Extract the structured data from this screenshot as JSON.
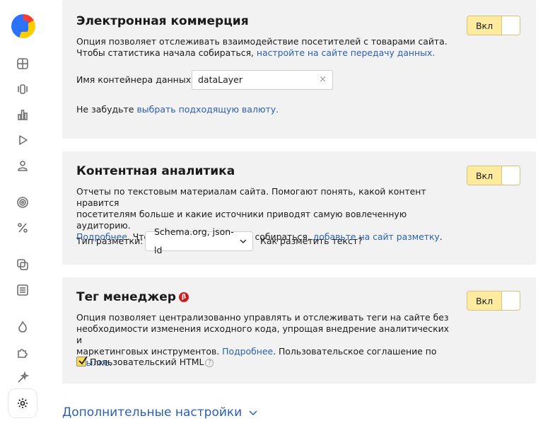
{
  "sidebar": {
    "icons": [
      "grid-icon",
      "layers-icon",
      "bar-chart-icon",
      "play-icon",
      "user-icon",
      "target-icon",
      "percent-icon",
      "copy-icon",
      "list-icon",
      "flame-icon",
      "puzzle-icon",
      "sparkle-icon",
      "gear-icon"
    ]
  },
  "ecommerce": {
    "title": "Электронная коммерция",
    "toggle_label": "Вкл",
    "desc_line1": "Опция позволяет отслеживать взаимодействие посетителей с товарами сайта.",
    "desc_line2_prefix": "Чтобы статистика начала собираться, ",
    "desc_line2_link": "настройте на сайте передачу данных.",
    "container_label": "Имя контейнера данных:",
    "container_value": "dataLayer",
    "clear_symbol": "×",
    "currency_prefix": "Не забудьте ",
    "currency_link": "выбрать подходящую валюту."
  },
  "content": {
    "title": "Контентная аналитика",
    "toggle_label": "Вкл",
    "desc_line1": "Отчеты по текстовым материалам сайта. Помогают понять, какой контент нравится",
    "desc_line2": "посетителям больше и какие источники приводят самую вовлеченную аудиторию.",
    "desc_more_link": "Подробнее",
    "desc_line3_mid": ". Чтобы статистика начала собираться, ",
    "desc_line3_link": "добавьте на сайт разметку",
    "desc_line3_end": ".",
    "markup_label": "Тип разметки:",
    "markup_value": "Schema.org, json-ld",
    "markup_help_link": "Как разметить текст?"
  },
  "tagmanager": {
    "title": "Тег менеджер",
    "beta": "β",
    "toggle_label": "Вкл",
    "desc_line1": "Опция позволяет централизованно управлять и отслеживать теги на сайте без",
    "desc_line2": "необходимости изменения исходного кода, упрощая внедрение аналитических и",
    "desc_line3_prefix": "маркетинговых инструментов. ",
    "desc_more_link": "Подробнее",
    "desc_line3_mid": ". Пользовательское соглашение по ",
    "desc_agreement_link": "ссылке",
    "desc_line3_end": ".",
    "checkbox_label": "Пользовательский HTML",
    "help_symbol": "?"
  },
  "advanced_label": "Дополнительные настройки"
}
